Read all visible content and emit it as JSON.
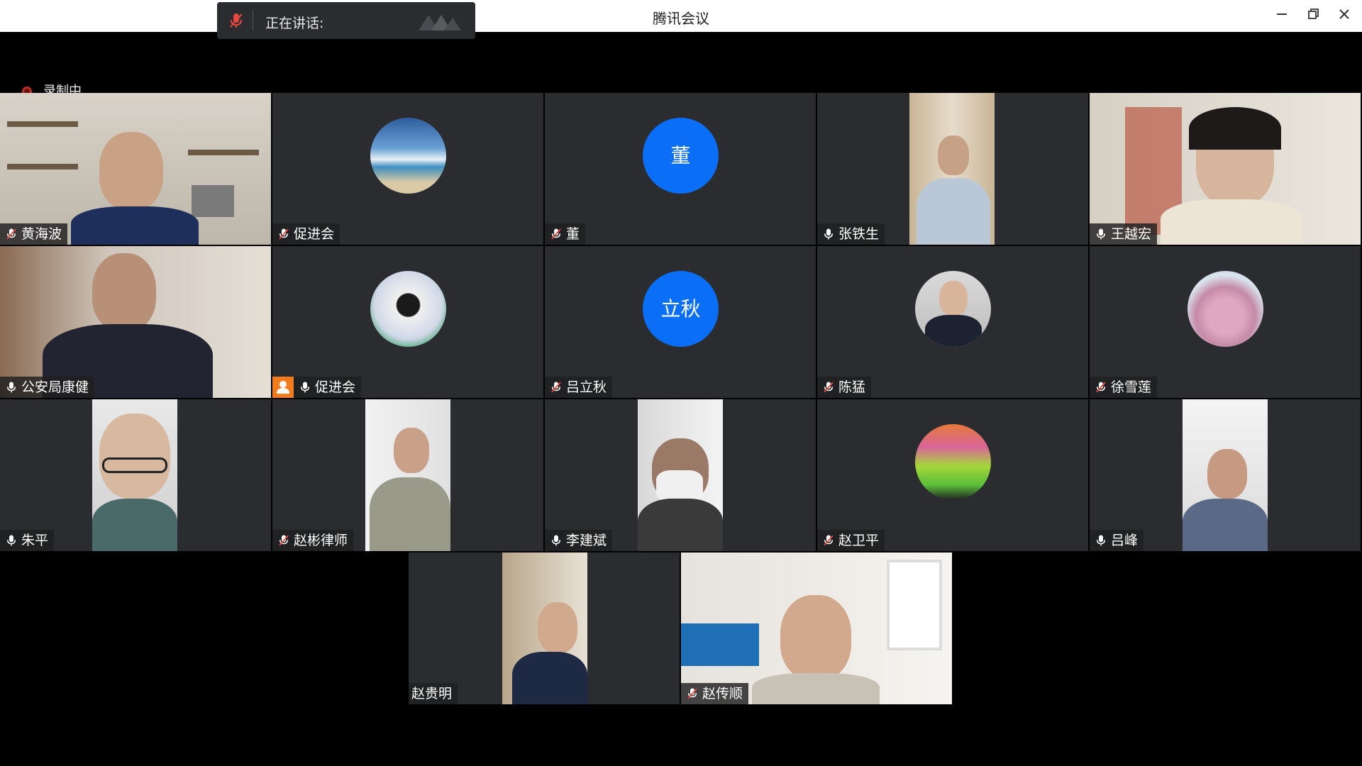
{
  "window": {
    "title": "腾讯会议",
    "controls": [
      "minimize-icon",
      "restore-icon",
      "close-icon"
    ]
  },
  "speaking": {
    "label": "正在讲话:"
  },
  "recording": {
    "label": "录制中"
  },
  "colors": {
    "tile_bg": "#2b2c30",
    "avatar_blue": "#0b6ef6",
    "muted_red": "#e5483f",
    "host_orange": "#f07c1e"
  },
  "participants": [
    {
      "name": "黄海波",
      "mic": "muted",
      "display": "video"
    },
    {
      "name": "促进会",
      "mic": "muted",
      "display": "avatar-image"
    },
    {
      "name": "董",
      "mic": "muted",
      "display": "avatar-text",
      "avatar_text": "董"
    },
    {
      "name": "张铁生",
      "mic": "on",
      "display": "video"
    },
    {
      "name": "王越宏",
      "mic": "on",
      "display": "video"
    },
    {
      "name": "公安局康健",
      "mic": "on",
      "display": "video"
    },
    {
      "name": "促进会",
      "mic": "on",
      "display": "avatar-image",
      "host": true
    },
    {
      "name": "吕立秋",
      "mic": "muted",
      "display": "avatar-text",
      "avatar_text": "立秋"
    },
    {
      "name": "陈猛",
      "mic": "muted",
      "display": "avatar-image"
    },
    {
      "name": "徐雪莲",
      "mic": "muted",
      "display": "avatar-image"
    },
    {
      "name": "朱平",
      "mic": "on",
      "display": "video"
    },
    {
      "name": "赵彬律师",
      "mic": "muted",
      "display": "video"
    },
    {
      "name": "李建斌",
      "mic": "on",
      "display": "video"
    },
    {
      "name": "赵卫平",
      "mic": "muted",
      "display": "avatar-image"
    },
    {
      "name": "吕峰",
      "mic": "on",
      "display": "video"
    },
    {
      "name": "赵贵明",
      "mic": "none",
      "display": "video"
    },
    {
      "name": "赵传顺",
      "mic": "muted",
      "display": "video"
    }
  ]
}
